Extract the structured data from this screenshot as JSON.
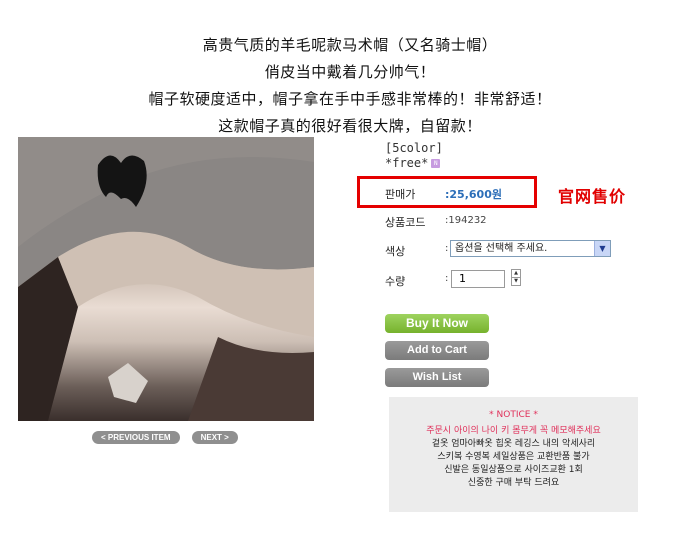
{
  "intro": {
    "lines": [
      "高贵气质的羊毛呢款马术帽（又名骑士帽）",
      "俏皮当中戴着几分帅气！",
      "帽子软硬度适中，帽子拿在手中手感非常棒的！非常舒适！",
      "这款帽子真的很好看很大牌，自留款！"
    ]
  },
  "product": {
    "color_count": "[5color]",
    "size": "*free*",
    "size_icon": "new-icon",
    "price_label": "판매가",
    "price_value": ":25,600원",
    "price_annotation": "官网售价",
    "code_label": "상품코드",
    "code_value": ":194232",
    "color_label": "색상",
    "color_select_value": "옵션을 선택해 주세요.",
    "qty_label": "수량",
    "qty_value": "1",
    "colon": ":"
  },
  "buttons": {
    "buy_now": "Buy It Now",
    "add_to_cart": "Add to Cart",
    "wish_list": "Wish List"
  },
  "pager": {
    "prev": "< PREVIOUS ITEM",
    "next": "NEXT >"
  },
  "notice": {
    "title": "* NOTICE *",
    "lines": [
      "주문시 아이의 나이 키 몸무게 꼭 메모해주세요",
      "겉옷 엄마아빠옷 힙옷 레깅스 내의 악세사리",
      "스키복 수영복 세일상품은 교환반품 불가",
      "신발은 동일상품으로 사이즈교환 1회",
      "신중한 구매 부탁 드려요"
    ]
  },
  "colors": {
    "accent_red": "#e50000",
    "price_blue": "#2c6eb8",
    "buy_green": "#85c23f",
    "button_gray": "#8a8a8a",
    "notice_pink": "#e0305a"
  }
}
